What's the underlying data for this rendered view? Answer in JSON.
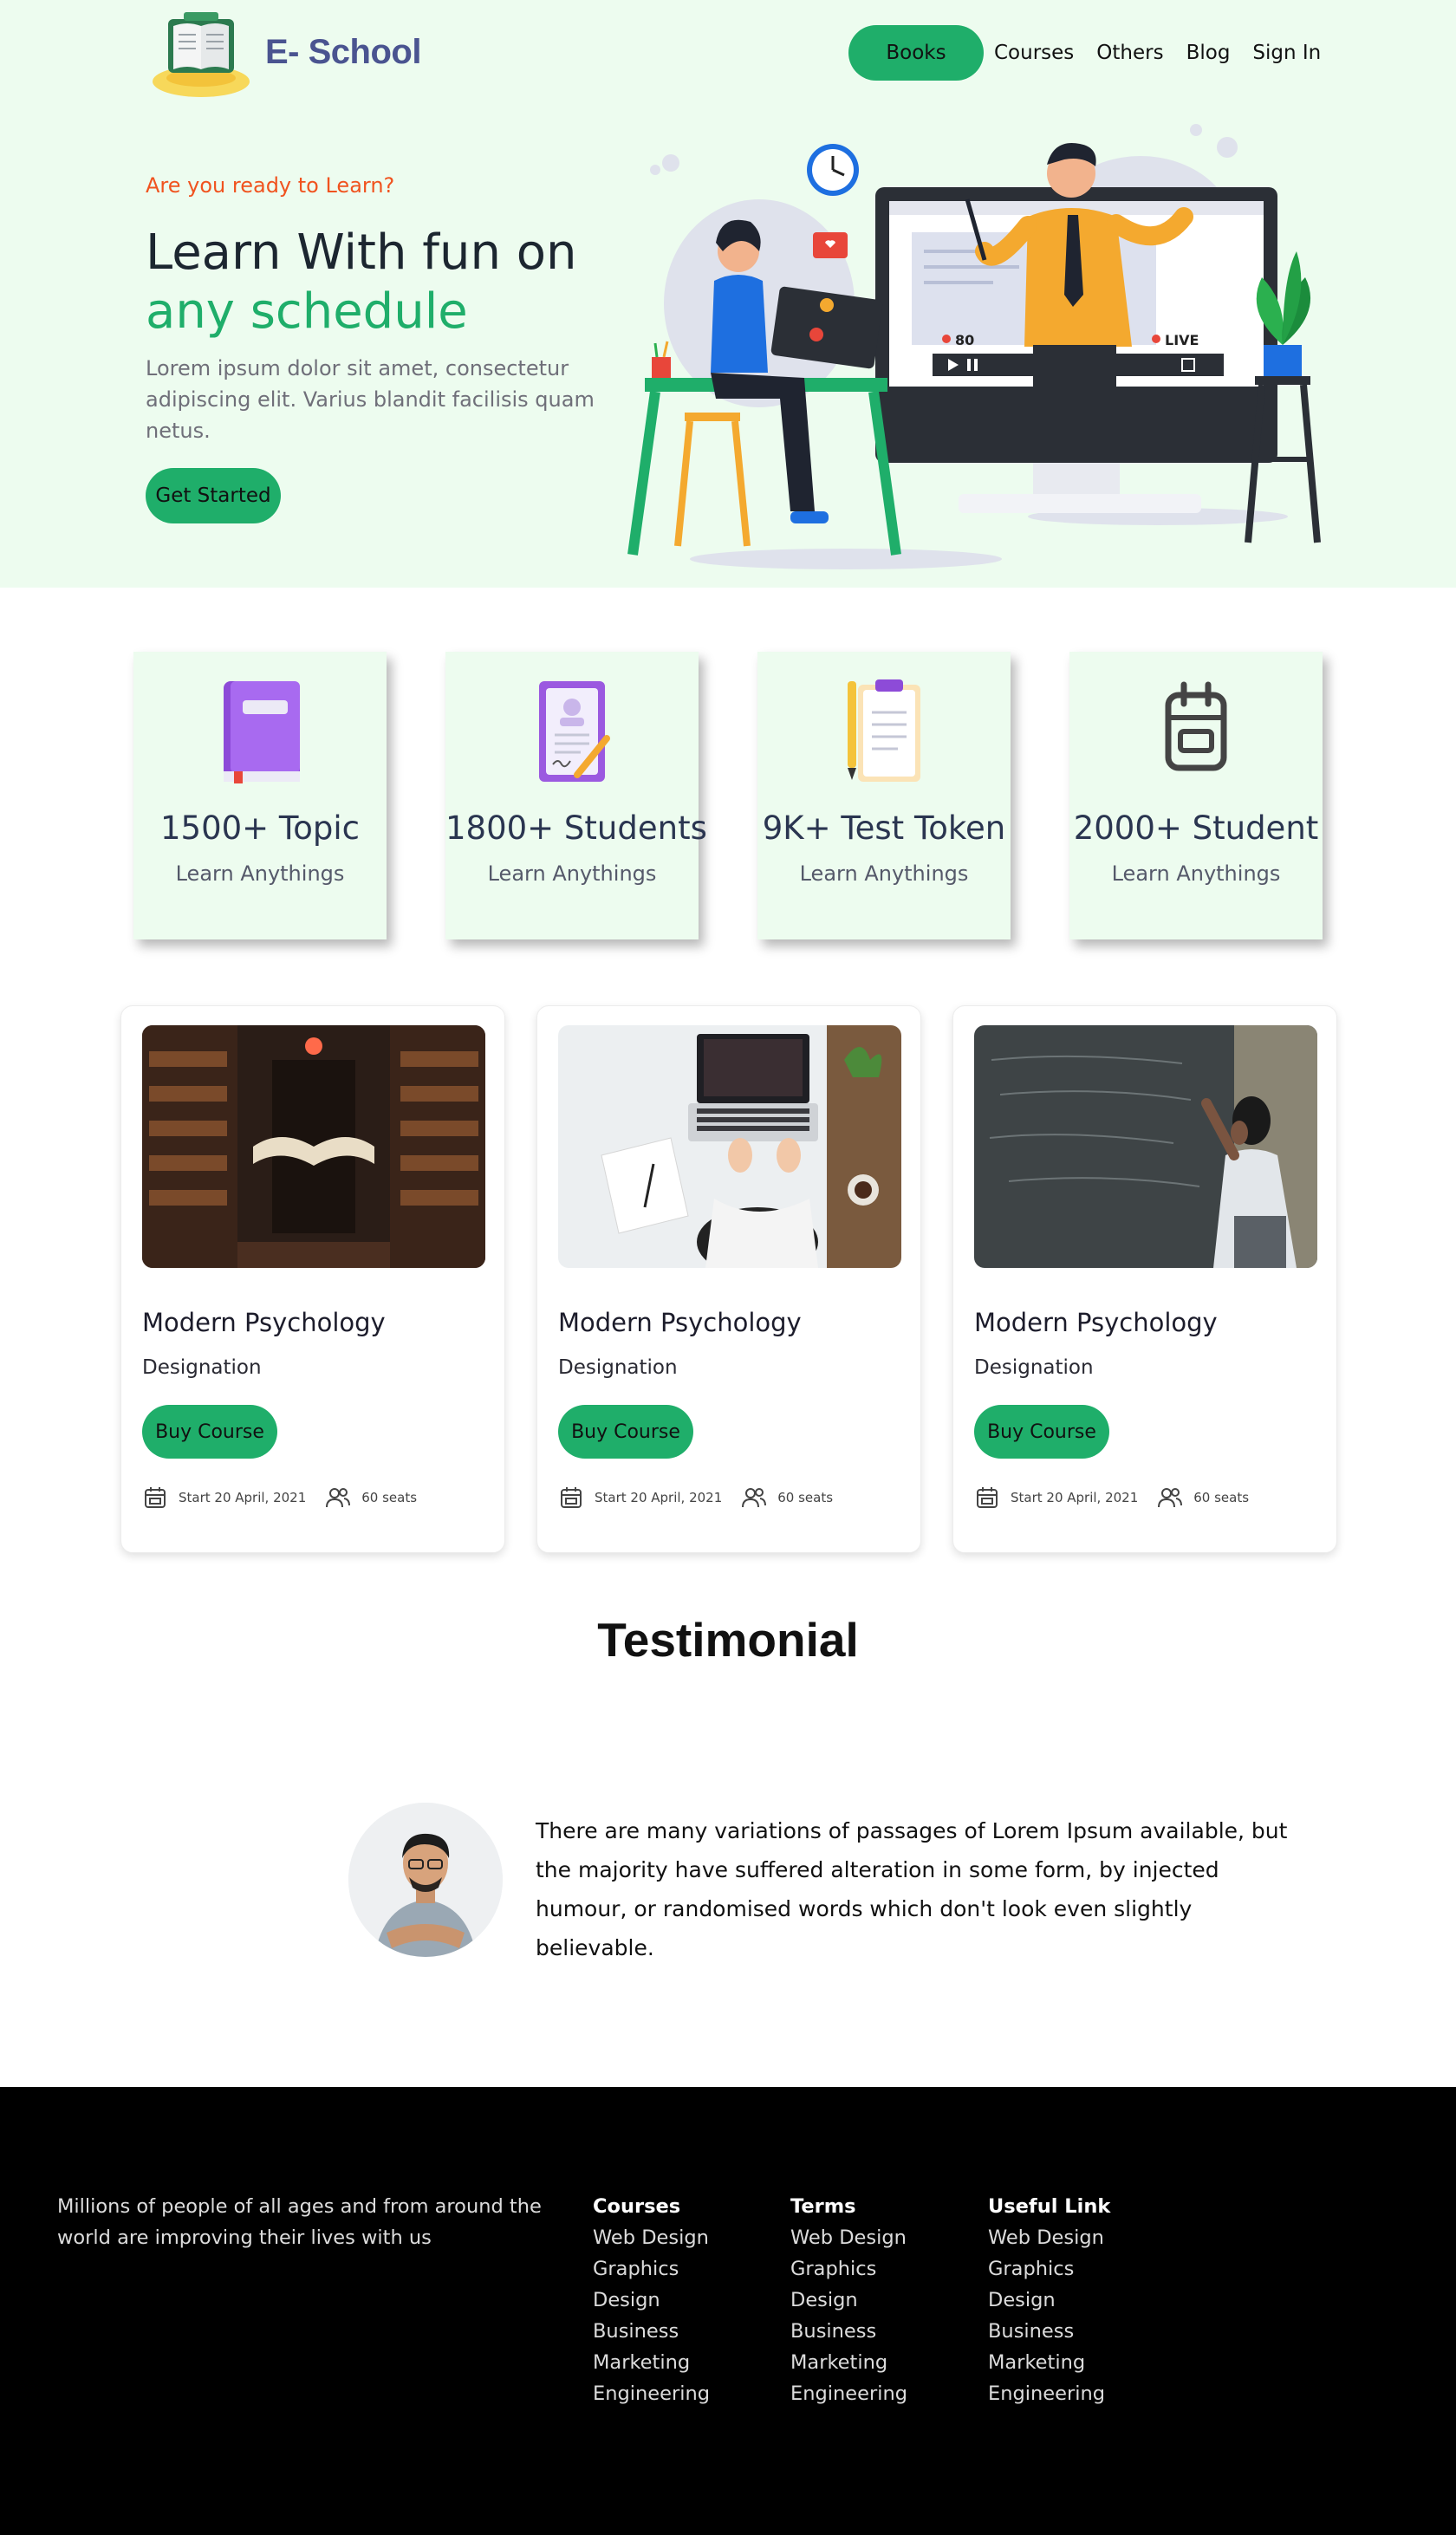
{
  "brand": {
    "name": "E- School"
  },
  "nav": {
    "items": [
      "Books",
      "Courses",
      "Others",
      "Blog",
      "Sign In"
    ]
  },
  "hero": {
    "eyebrow": "Are you ready to Learn?",
    "headline_1": "Learn With fun on",
    "headline_2": "any schedule",
    "lead": "Lorem ipsum dolor sit amet, consectetur adipiscing elit. Varius blandit facilisis quam netus.",
    "cta": "Get Started",
    "screen_viewers": "80",
    "screen_live": "LIVE"
  },
  "stats": [
    {
      "value": "1500+ Topic",
      "sub": "Learn Anythings",
      "icon": "book-icon"
    },
    {
      "value": "1800+ Students",
      "sub": "Learn Anythings",
      "icon": "id-card-icon"
    },
    {
      "value": "9K+ Test Token",
      "sub": "Learn Anythings",
      "icon": "clipboard-icon"
    },
    {
      "value": "2000+ Student",
      "sub": "Learn Anythings",
      "icon": "calendar-icon"
    }
  ],
  "courses": [
    {
      "title": "Modern Psychology",
      "sub": "Designation",
      "button": "Buy Course",
      "start": "Start 20 April, 2021",
      "seats": "60 seats"
    },
    {
      "title": "Modern Psychology",
      "sub": "Designation",
      "button": "Buy Course",
      "start": "Start 20 April, 2021",
      "seats": "60 seats"
    },
    {
      "title": "Modern Psychology",
      "sub": "Designation",
      "button": "Buy Course",
      "start": "Start 20 April, 2021",
      "seats": "60 seats"
    }
  ],
  "testimonial": {
    "title": "Testimonial",
    "quote": "There are many variations of passages of Lorem Ipsum available, but the majority have suffered alteration in some form, by injected humour, or randomised words which don't look even slightly believable."
  },
  "footer": {
    "about": "Millions of people of all ages and from around the world are improving their lives with us",
    "columns": [
      {
        "heading": "Courses",
        "links": [
          "Web Design",
          "Graphics",
          "Design",
          "Business",
          "Marketing",
          "Engineering"
        ]
      },
      {
        "heading": "Terms",
        "links": [
          "Web Design",
          "Graphics",
          "Design",
          "Business",
          "Marketing",
          "Engineering"
        ]
      },
      {
        "heading": "Useful Link",
        "links": [
          "Web Design",
          "Graphics",
          "Design",
          "Business",
          "Marketing",
          "Engineering"
        ]
      }
    ]
  },
  "colors": {
    "accent": "#1fae6a",
    "hero_bg": "#edfcef",
    "eyebrow": "#f0531f",
    "brand": "#4a5490",
    "footer_bg": "#000000"
  }
}
